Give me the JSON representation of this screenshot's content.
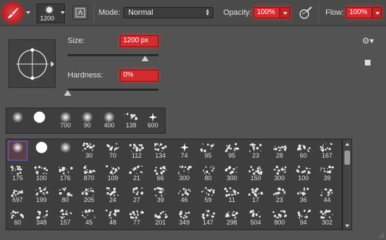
{
  "toolbar": {
    "brush_size": "1200",
    "mode_label": "Mode:",
    "mode_value": "Normal",
    "opacity_label": "Opacity:",
    "opacity_value": "100%",
    "flow_label": "Flow:",
    "flow_value": "100%",
    "accent_color": "#d52a2e"
  },
  "panel": {
    "size_label": "Size:",
    "size_value": "1200 px",
    "size_slider_fraction": 0.85,
    "hardness_label": "Hardness:",
    "hardness_value": "0%",
    "hardness_slider_fraction": 0.0,
    "gear_icon": "gear-icon"
  },
  "recent_brushes": [
    {
      "label": "",
      "style": "soft-round"
    },
    {
      "label": "",
      "style": "hard-round"
    },
    {
      "label": "700",
      "style": "soft-round"
    },
    {
      "label": "90",
      "style": "soft-round"
    },
    {
      "label": "400",
      "style": "soft-round"
    },
    {
      "label": "138",
      "style": "texture"
    },
    {
      "label": "600",
      "style": "star"
    }
  ],
  "brush_grid": [
    [
      "",
      "",
      "",
      "30",
      "70",
      "112",
      "134",
      "74",
      "95",
      "95",
      "23",
      "28",
      "60",
      "167"
    ],
    [
      "175",
      "100",
      "176",
      "870",
      "109",
      "21",
      "66",
      "300",
      "80",
      "300",
      "150",
      "300",
      "100",
      "39"
    ],
    [
      "697",
      "199",
      "80",
      "205",
      "24",
      "27",
      "39",
      "46",
      "59",
      "11",
      "17",
      "23",
      "36",
      "44"
    ],
    [
      "60",
      "348",
      "157",
      "45",
      "48",
      "77",
      "201",
      "349",
      "147",
      "298",
      "504",
      "800",
      "94",
      "302"
    ]
  ]
}
